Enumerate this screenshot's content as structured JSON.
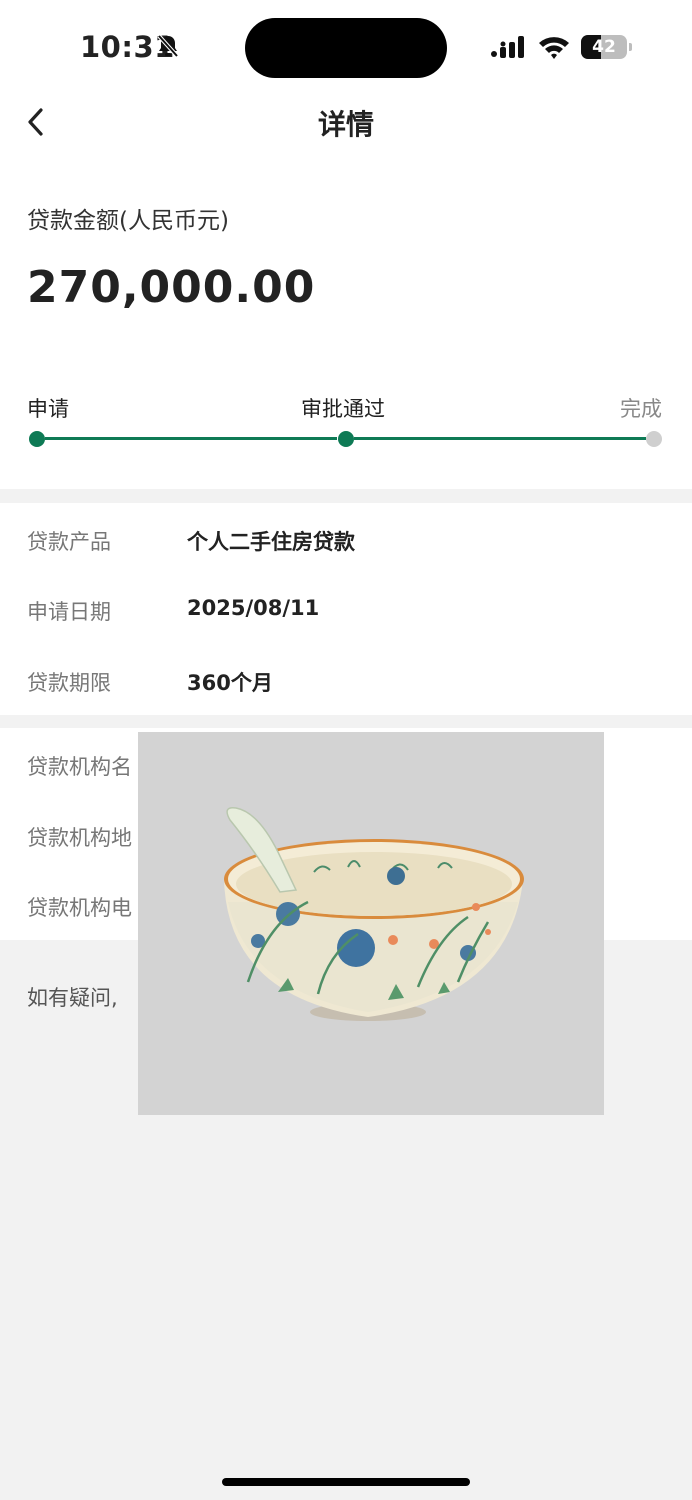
{
  "status_bar": {
    "time": "10:31",
    "battery": "42"
  },
  "header": {
    "title": "详情"
  },
  "amount": {
    "label": "贷款金额(人民币元)",
    "value": "270,000.00"
  },
  "progress": {
    "steps": [
      {
        "label": "申请",
        "state": "done"
      },
      {
        "label": "审批通过",
        "state": "current"
      },
      {
        "label": "完成",
        "state": "pending"
      }
    ]
  },
  "details": [
    {
      "label": "贷款产品",
      "value": "个人二手住房贷款"
    },
    {
      "label": "申请日期",
      "value": "2025/08/11"
    },
    {
      "label": "贷款期限",
      "value": "360个月"
    }
  ],
  "institution": [
    {
      "label": "贷款机构名"
    },
    {
      "label": "贷款机构地"
    },
    {
      "label": "贷款机构电"
    }
  ],
  "help_text": "如有疑问,",
  "colors": {
    "accent": "#0e7a55",
    "pending_dot": "#cfcfcf",
    "page_bg": "#f2f2f2"
  }
}
